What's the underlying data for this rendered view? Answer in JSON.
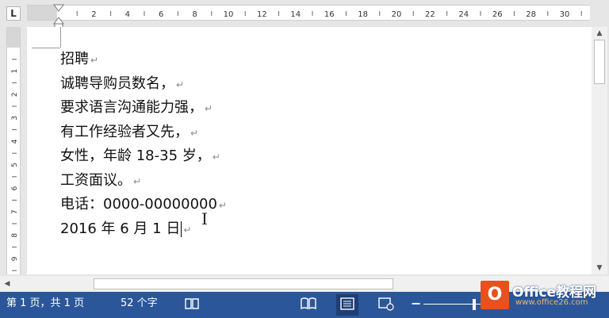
{
  "ruler": {
    "tab_stop_label": "L",
    "numbers": [
      "2",
      "4",
      "6",
      "8",
      "10",
      "12",
      "14",
      "16",
      "18",
      "20",
      "22",
      "24",
      "26",
      "28",
      "30"
    ],
    "vertical_numbers": [
      "1",
      "2",
      "3",
      "4",
      "5",
      "6",
      "7",
      "8",
      "9"
    ]
  },
  "document": {
    "lines": [
      "招聘",
      "诚聘导购员数名，",
      "要求语言沟通能力强，",
      "有工作经验者又先，",
      "女性，年龄 18-35 岁，",
      "工资面议。",
      "电话：0000-00000000",
      "2016 年 6 月 1 日"
    ],
    "paragraph_mark": "↵",
    "ibeam": "I"
  },
  "statusbar": {
    "page_info": "第 1 页，共 1 页",
    "word_count": "52 个字",
    "zoom_minus": "−",
    "zoom_plus": "+",
    "zoom_level_fraction": 0.64
  },
  "watermark": {
    "badge": "O",
    "title": "Office教程网",
    "url": "www.office26.com"
  },
  "colors": {
    "statusbar": "#2b579a",
    "logo_badge": "#e8501f"
  },
  "icons": {
    "proofing": "book-check-icon",
    "read_mode": "read-mode-icon",
    "print_layout": "print-layout-icon",
    "web_layout": "web-layout-icon"
  }
}
